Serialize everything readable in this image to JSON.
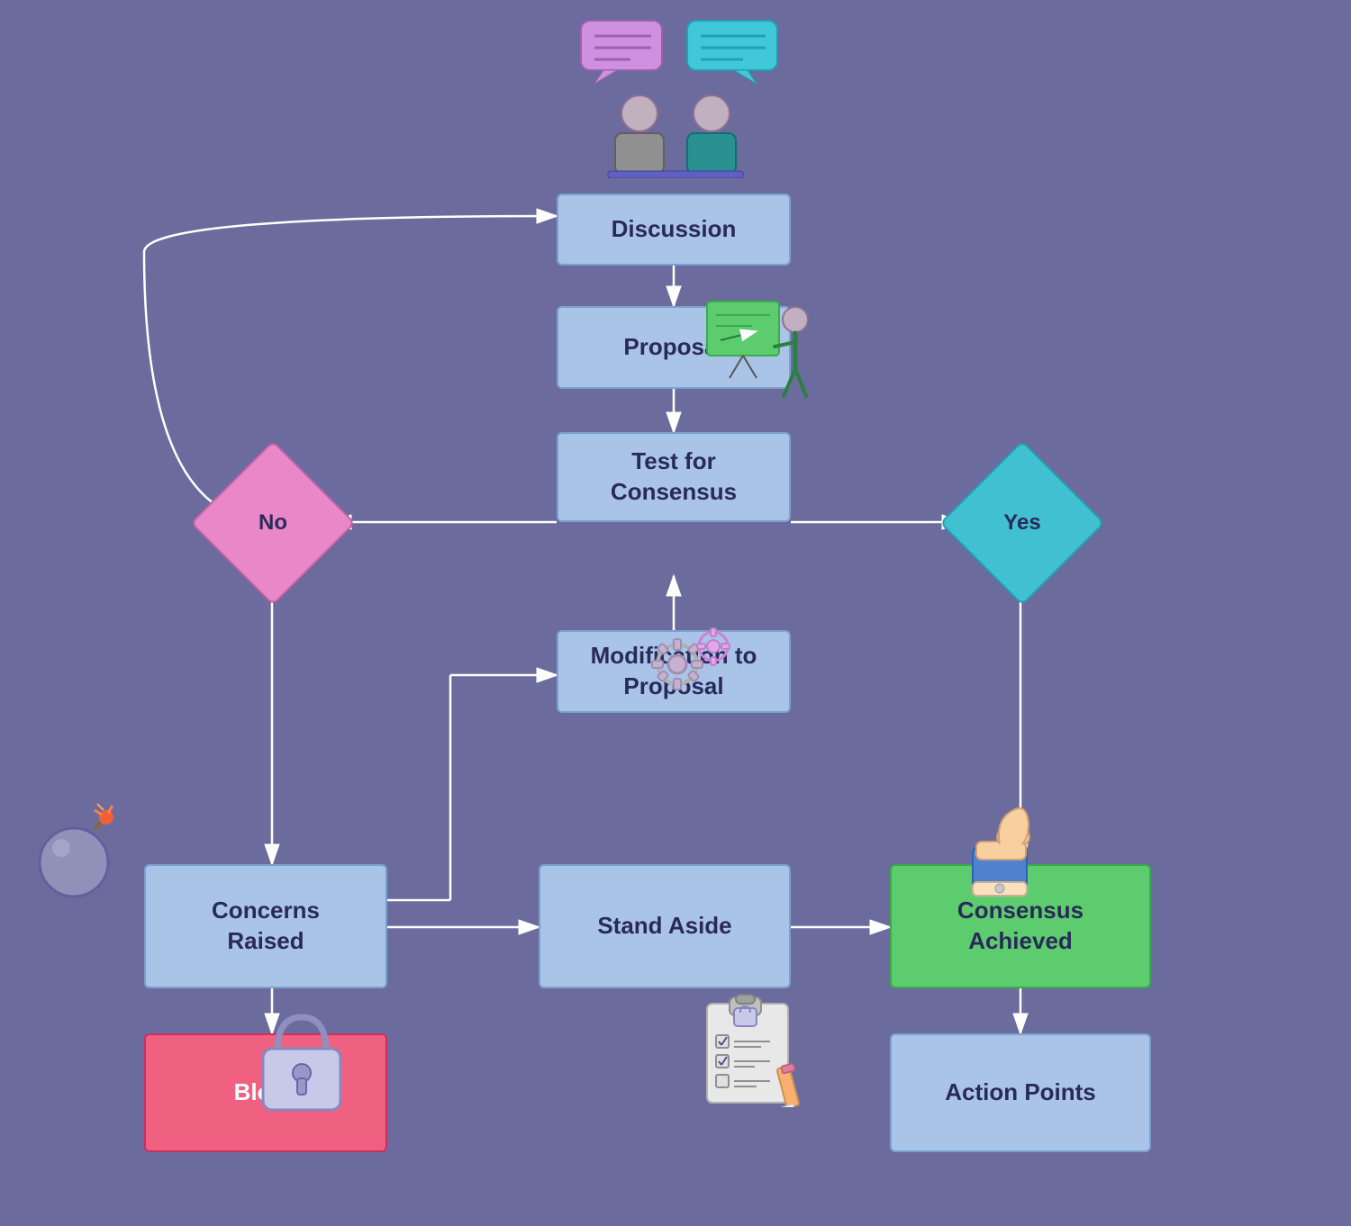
{
  "nodes": {
    "discussion": {
      "label": "Discussion"
    },
    "proposal": {
      "label": "Proposal"
    },
    "test_consensus": {
      "label": "Test for\nConsensus"
    },
    "modification": {
      "label": "Modification to\nProposal"
    },
    "concerns": {
      "label": "Concerns\nRaised"
    },
    "stand_aside": {
      "label": "Stand Aside"
    },
    "consensus_achieved": {
      "label": "Consensus\nAchieved"
    },
    "block": {
      "label": "Block"
    },
    "action_points": {
      "label": "Action Points"
    },
    "no": {
      "label": "No"
    },
    "yes": {
      "label": "Yes"
    }
  },
  "colors": {
    "background": "#6b6b9e",
    "box_blue": "#aac4e8",
    "box_green": "#5dcc6e",
    "box_pink": "#f06080",
    "diamond_pink": "#e888c8",
    "diamond_teal": "#40c0d0",
    "arrow": "#ffffff"
  }
}
